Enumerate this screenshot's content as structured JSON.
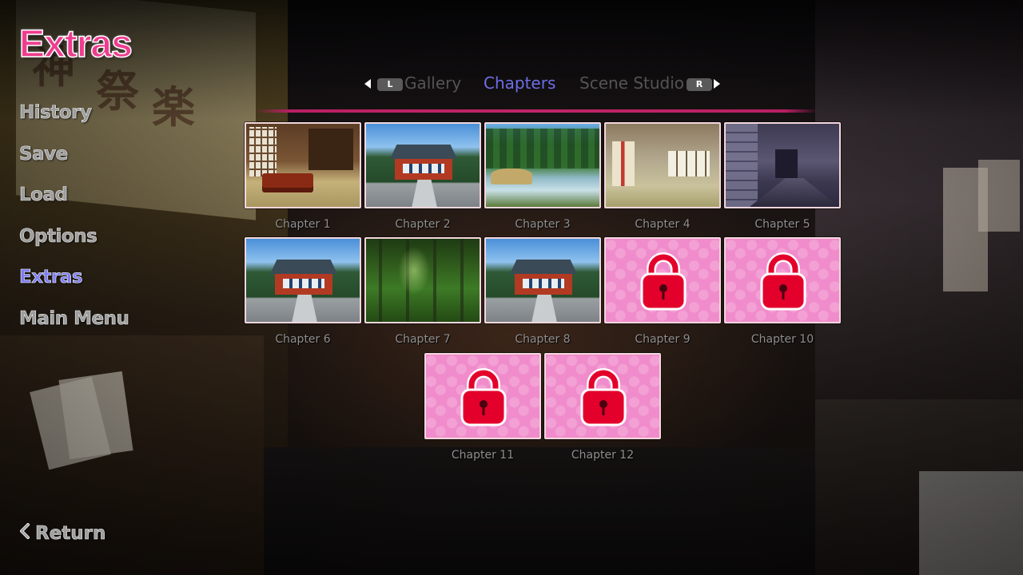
{
  "screen": {
    "title": "Extras",
    "accent_color": "#ee3d8f",
    "active_color": "#6f6ee6",
    "underline_color": "#c02468"
  },
  "side_menu": {
    "items": [
      {
        "label": "History",
        "active": false
      },
      {
        "label": "Save",
        "active": false
      },
      {
        "label": "Load",
        "active": false
      },
      {
        "label": "Options",
        "active": false
      },
      {
        "label": "Extras",
        "active": true
      },
      {
        "label": "Main Menu",
        "active": false
      }
    ],
    "return_label": "Return",
    "return_icon": "chevron-left-icon"
  },
  "tabs": {
    "prev_key": "L",
    "next_key": "R",
    "items": [
      {
        "label": "Gallery",
        "active": false
      },
      {
        "label": "Chapters",
        "active": true
      },
      {
        "label": "Scene Studio",
        "active": false
      }
    ]
  },
  "chapters": [
    {
      "label": "Chapter 1",
      "locked": false,
      "scene": "japanese-room"
    },
    {
      "label": "Chapter 2",
      "locked": false,
      "scene": "shrine"
    },
    {
      "label": "Chapter 3",
      "locked": false,
      "scene": "forest-river"
    },
    {
      "label": "Chapter 4",
      "locked": false,
      "scene": "tatami-room"
    },
    {
      "label": "Chapter 5",
      "locked": false,
      "scene": "corridor"
    },
    {
      "label": "Chapter 6",
      "locked": false,
      "scene": "shrine"
    },
    {
      "label": "Chapter 7",
      "locked": false,
      "scene": "deep-forest"
    },
    {
      "label": "Chapter 8",
      "locked": false,
      "scene": "shrine"
    },
    {
      "label": "Chapter 9",
      "locked": true,
      "scene": "lock-icon"
    },
    {
      "label": "Chapter 10",
      "locked": true,
      "scene": "lock-icon"
    },
    {
      "label": "Chapter 11",
      "locked": true,
      "scene": "lock-icon"
    },
    {
      "label": "Chapter 12",
      "locked": true,
      "scene": "lock-icon"
    }
  ],
  "lock_colors": {
    "tile": "#f08ccb",
    "lock": "#e3002b"
  }
}
